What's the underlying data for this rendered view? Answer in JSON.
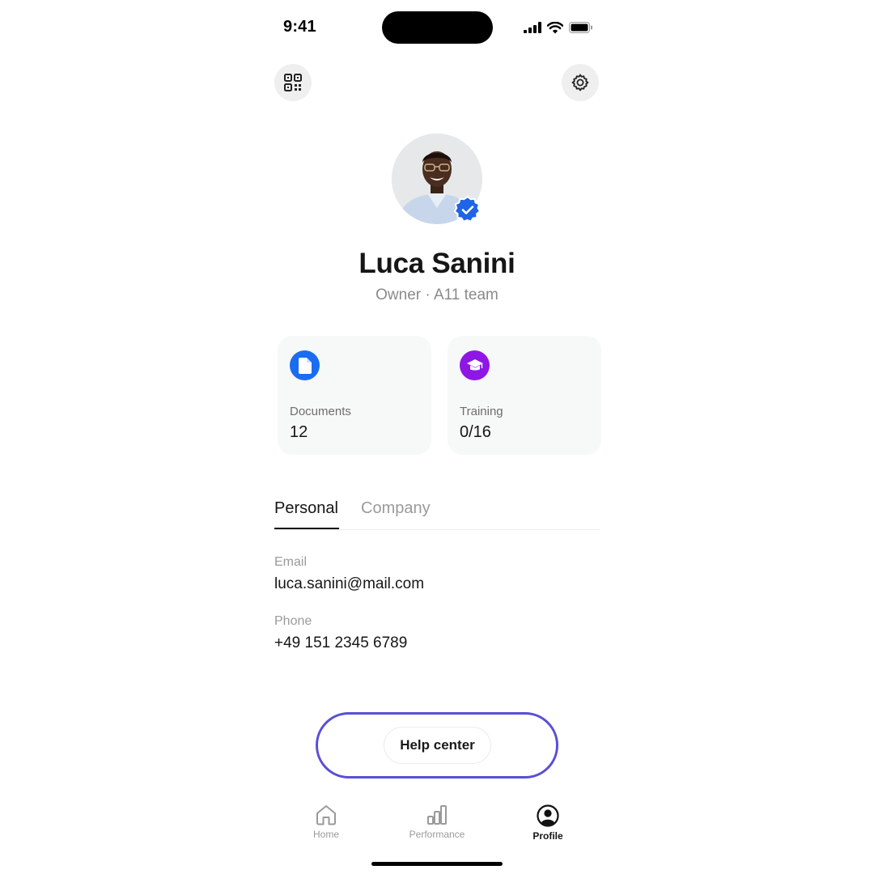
{
  "status_bar": {
    "time": "9:41"
  },
  "profile": {
    "name": "Luca Sanini",
    "subtitle": "Owner · A11 team"
  },
  "stats": [
    {
      "label": "Documents",
      "value": "12",
      "icon": "document-icon",
      "color": "#1a6df0"
    },
    {
      "label": "Training",
      "value": "0/16",
      "icon": "graduation-cap-icon",
      "color": "#8e17e6"
    }
  ],
  "tabs": [
    {
      "label": "Personal",
      "active": true
    },
    {
      "label": "Company",
      "active": false
    }
  ],
  "fields": [
    {
      "label": "Email",
      "value": "luca.sanini@mail.com"
    },
    {
      "label": "Phone",
      "value": "+49 151 2345 6789"
    }
  ],
  "help": {
    "label": "Help center",
    "highlight_color": "#5a4fd6"
  },
  "nav": [
    {
      "label": "Home",
      "icon": "home-icon",
      "active": false
    },
    {
      "label": "Performance",
      "icon": "bar-chart-icon",
      "active": false
    },
    {
      "label": "Profile",
      "icon": "user-icon",
      "active": true
    }
  ]
}
